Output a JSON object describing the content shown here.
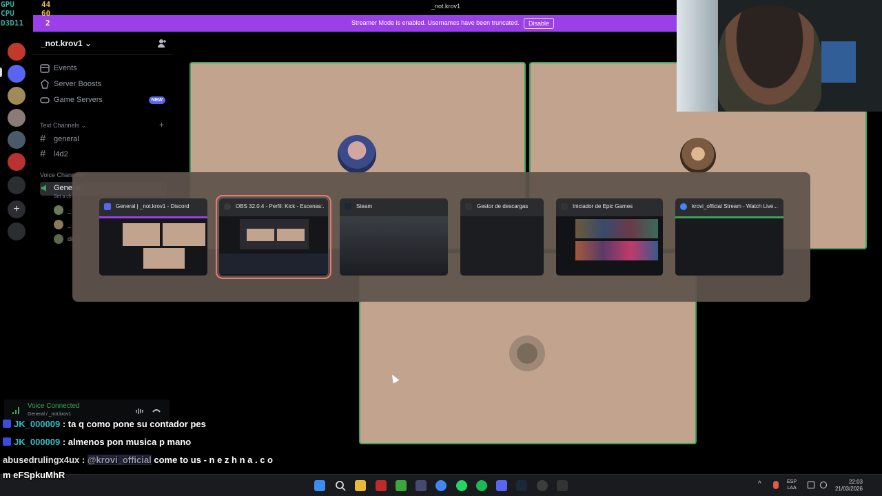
{
  "perf": {
    "gpu_label": "GPU",
    "gpu_value": "44",
    "cpu_label": "CPU",
    "cpu_value": "60",
    "fps_label": "D3D11",
    "fps_value": "2"
  },
  "window": {
    "title": "_not.krov1"
  },
  "banner": {
    "text": "Streamer Mode is enabled. Usernames have been truncated.",
    "disable_label": "Disable"
  },
  "sidebar": {
    "server_name": "_not.krov1 ⌄",
    "items": [
      {
        "label": "Events"
      },
      {
        "label": "Server Boosts"
      },
      {
        "label": "Game Servers",
        "badge": "NEW"
      }
    ],
    "text_category": "Text Channels ⌄",
    "text_channels": [
      "general",
      "l4d2"
    ],
    "voice_category": "Voice Channels",
    "voice_channel": "General",
    "voice_sub": "Set a ch",
    "voice_members": [
      "_",
      "_",
      "di"
    ]
  },
  "voice": {
    "status": "Voice Connected",
    "channel": "General / _not.krov1"
  },
  "alttab": {
    "apps": [
      {
        "title": "General | _not.krov1 - Discord",
        "icon_color": "#5865f2"
      },
      {
        "title": "OBS 32.0.4 - Perfil: Kick - Escenas:...",
        "icon_color": "#3c3c3c"
      },
      {
        "title": "Steam",
        "icon_color": "#1b2838"
      },
      {
        "title": "Gestor de descargas",
        "icon_color": "#222222"
      },
      {
        "title": "Iniciador de Epic Games",
        "icon_color": "#2a2a2a"
      },
      {
        "title": "krovi_official Stream - Watch Live...",
        "icon_color": "#4285f4"
      }
    ]
  },
  "chat": [
    {
      "user": "JK_000009",
      "text": ": ta q como pone su contador pes"
    },
    {
      "user": "JK_000009",
      "text": ": almenos pon musica p mano"
    },
    {
      "user": "abusedrulingx4ux",
      "text": ":",
      "mention": "@krovi_official",
      "text2": "come to us - n e z h n a . c o"
    },
    {
      "user": "",
      "text": "m eFSpkuMhR"
    }
  ],
  "taskbar": {
    "lang_top": "ESP",
    "lang_bottom": "LAA",
    "time": "22:03",
    "date": "21/03/2026"
  },
  "colors": {
    "accent": "#5865f2",
    "banner": "#9b3fe8",
    "tile_border": "#3ea35a",
    "tile_bg": "#c2a48e"
  }
}
